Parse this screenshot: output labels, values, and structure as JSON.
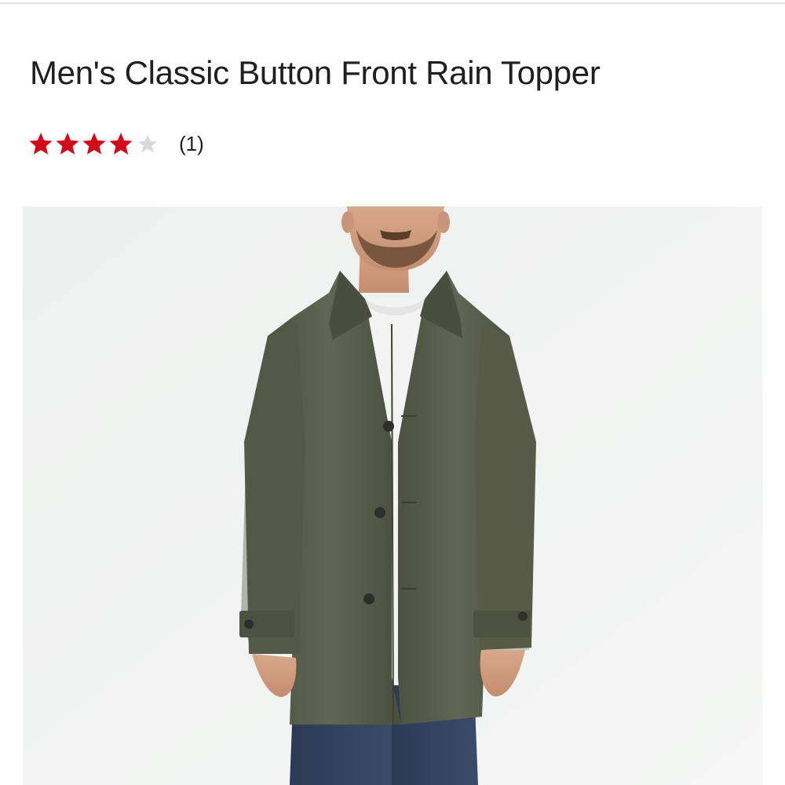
{
  "product": {
    "title": "Men's Classic Button Front Rain Topper",
    "rating": {
      "value": 4,
      "max": 5,
      "count_label": "(1)",
      "filled_color": "#d20a1a",
      "empty_color": "#d9d9d9"
    },
    "image": {
      "subject": "man wearing olive green button-front rain coat over white t-shirt and jeans",
      "background_color": "#f2f3f2",
      "coat_color": "#5b5f4b"
    }
  }
}
